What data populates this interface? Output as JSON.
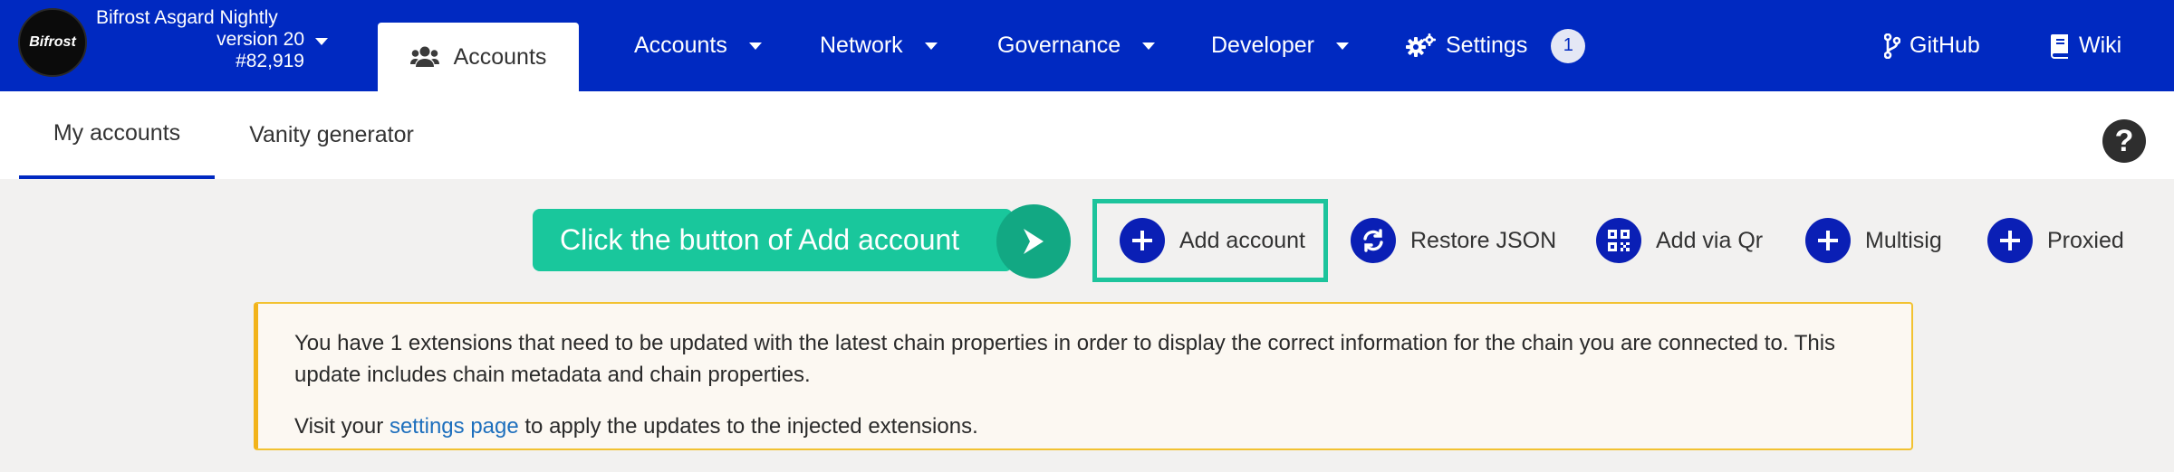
{
  "header": {
    "logo_text": "Bifrost",
    "chain_name": "Bifrost Asgard Nightly",
    "version": "version 20",
    "block": "#82,919",
    "active_tab": "Accounts",
    "nav": [
      {
        "label": "Accounts"
      },
      {
        "label": "Network"
      },
      {
        "label": "Governance"
      },
      {
        "label": "Developer"
      }
    ],
    "settings": {
      "label": "Settings",
      "badge": "1"
    },
    "github": "GitHub",
    "wiki": "Wiki",
    "colors": {
      "bar": "#0029c1",
      "accent": "#19c79c",
      "warning_border": "#f2c231"
    }
  },
  "subtabs": [
    {
      "label": "My accounts",
      "active": true
    },
    {
      "label": "Vanity generator",
      "active": false
    }
  ],
  "callout": {
    "text": "Click the button of Add account"
  },
  "actions": [
    {
      "label": "Add account",
      "icon": "plus-icon"
    },
    {
      "label": "Restore JSON",
      "icon": "sync-icon"
    },
    {
      "label": "Add via Qr",
      "icon": "qrcode-icon"
    },
    {
      "label": "Multisig",
      "icon": "plus-icon"
    },
    {
      "label": "Proxied",
      "icon": "plus-icon"
    }
  ],
  "warning": {
    "line1": "You have 1 extensions that need to be updated with the latest chain properties in order to display the correct information for the chain you are connected to. This update includes chain metadata and chain properties.",
    "line2_prefix": "Visit your ",
    "link": "settings page",
    "line2_suffix": " to apply the updates to the injected extensions."
  }
}
